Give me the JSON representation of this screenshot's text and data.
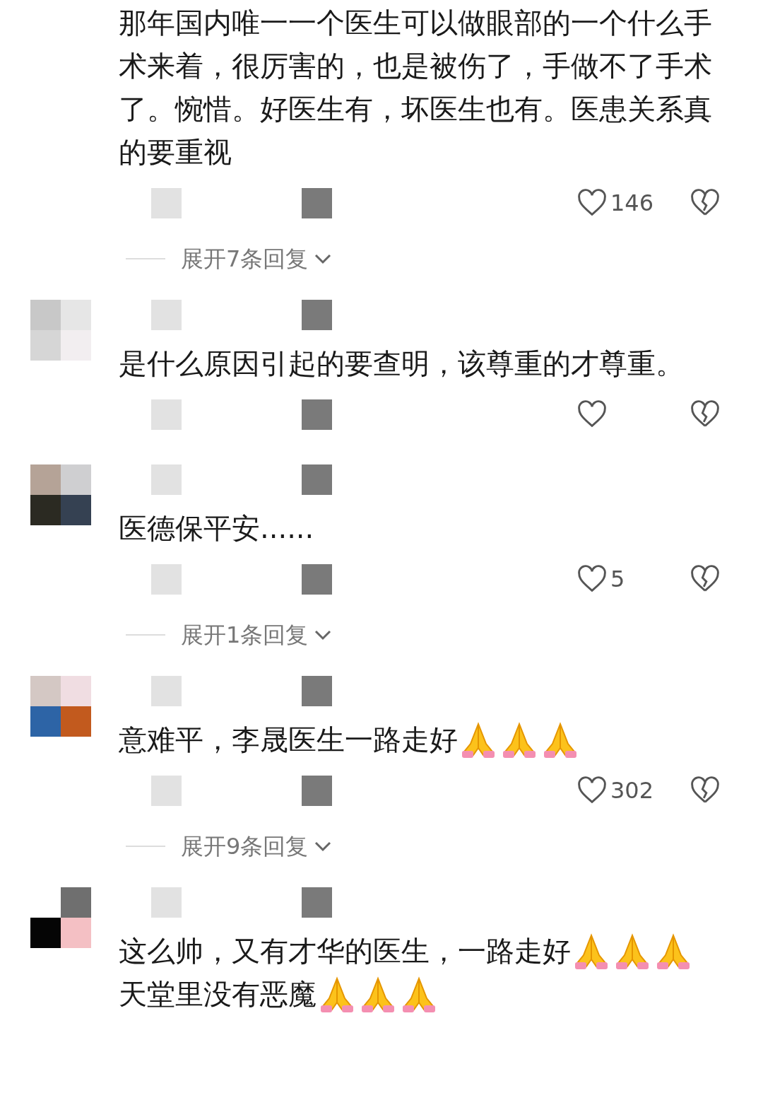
{
  "comments": [
    {
      "avatar": false,
      "lines": [
        [
          {
            "kind": "text",
            "text": "那年国内唯一一个医生可以做眼部的一个什么手术来着，很厉害的，也是被伤了，手做不了手术了。惋惜。好医生有，坏医生也有。医患关系真的要重视"
          }
        ]
      ],
      "likes": "146",
      "replies": "展开7条回复"
    },
    {
      "avatar": true,
      "lines": [
        [
          {
            "kind": "text",
            "text": "是什么原因引起的要查明，该尊重的才尊重。"
          }
        ]
      ]
    },
    {
      "avatar": true,
      "lines": [
        [
          {
            "kind": "text",
            "text": "医德保平安......"
          }
        ]
      ],
      "likes": "5",
      "replies": "展开1条回复"
    },
    {
      "avatar": true,
      "lines": [
        [
          {
            "kind": "text",
            "text": "意难平，李晟医生一路走好"
          },
          {
            "kind": "praying_hands"
          },
          {
            "kind": "praying_hands"
          },
          {
            "kind": "praying_hands"
          }
        ]
      ],
      "likes": "302",
      "replies": "展开9条回复"
    },
    {
      "avatar": true,
      "lines": [
        [
          {
            "kind": "text",
            "text": "这么帅，又有才华的医生，一路走好"
          },
          {
            "kind": "praying_hands"
          },
          {
            "kind": "praying_hands"
          },
          {
            "kind": "praying_hands"
          }
        ],
        [
          {
            "kind": "text",
            "text": "天堂里没有恶魔"
          },
          {
            "kind": "praying_hands"
          },
          {
            "kind": "praying_hands"
          },
          {
            "kind": "praying_hands"
          }
        ]
      ]
    }
  ]
}
